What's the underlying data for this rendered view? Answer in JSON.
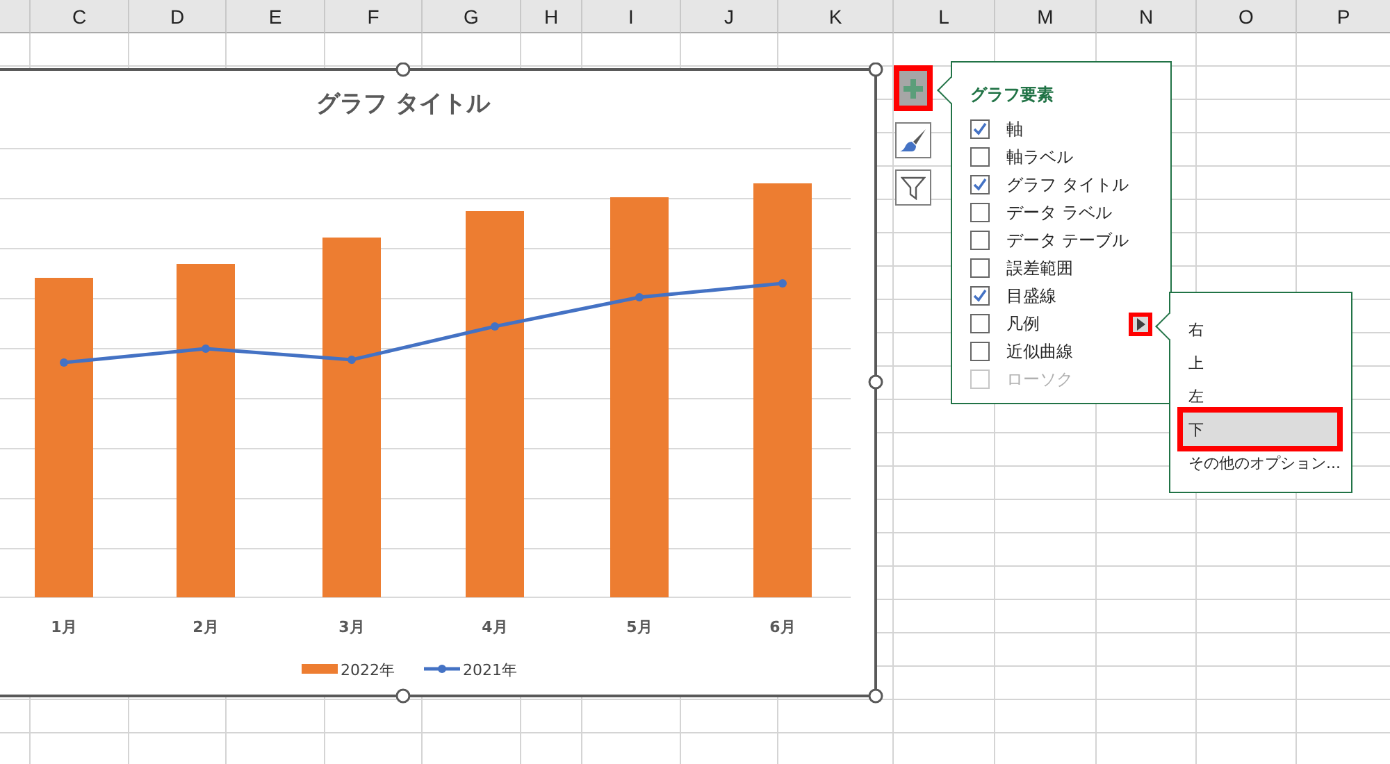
{
  "columns": [
    "C",
    "D",
    "E",
    "F",
    "G",
    "H",
    "I",
    "J",
    "K",
    "L",
    "M",
    "N",
    "O",
    "P"
  ],
  "chart": {
    "title": "グラフ タイトル",
    "categories": [
      "1月",
      "2月",
      "3月",
      "4月",
      "5月",
      "6月"
    ],
    "legend": [
      {
        "label": "2022年",
        "kind": "bar",
        "color": "#ed7d31"
      },
      {
        "label": "2021年",
        "kind": "line",
        "color": "#4472c4"
      }
    ]
  },
  "chart_buttons": [
    {
      "kind": "plus",
      "selected": true
    },
    {
      "kind": "brush",
      "selected": false
    },
    {
      "kind": "filter",
      "selected": false
    }
  ],
  "elements_panel": {
    "title": "グラフ要素",
    "items": [
      {
        "label": "軸",
        "checked": true,
        "disabled": false,
        "expanded": false
      },
      {
        "label": "軸ラベル",
        "checked": false,
        "disabled": false,
        "expanded": false
      },
      {
        "label": "グラフ タイトル",
        "checked": true,
        "disabled": false,
        "expanded": false
      },
      {
        "label": "データ ラベル",
        "checked": false,
        "disabled": false,
        "expanded": false
      },
      {
        "label": "データ テーブル",
        "checked": false,
        "disabled": false,
        "expanded": false
      },
      {
        "label": "誤差範囲",
        "checked": false,
        "disabled": false,
        "expanded": false
      },
      {
        "label": "目盛線",
        "checked": true,
        "disabled": false,
        "expanded": false
      },
      {
        "label": "凡例",
        "checked": false,
        "disabled": false,
        "expanded": true
      },
      {
        "label": "近似曲線",
        "checked": false,
        "disabled": false,
        "expanded": false
      },
      {
        "label": "ローソク",
        "checked": false,
        "disabled": true,
        "expanded": false
      }
    ]
  },
  "legend_submenu": {
    "items": [
      {
        "label": "右",
        "selected": false
      },
      {
        "label": "上",
        "selected": false
      },
      {
        "label": "左",
        "selected": false
      },
      {
        "label": "下",
        "selected": true
      },
      {
        "label": "その他のオプション...",
        "selected": false
      }
    ]
  }
}
